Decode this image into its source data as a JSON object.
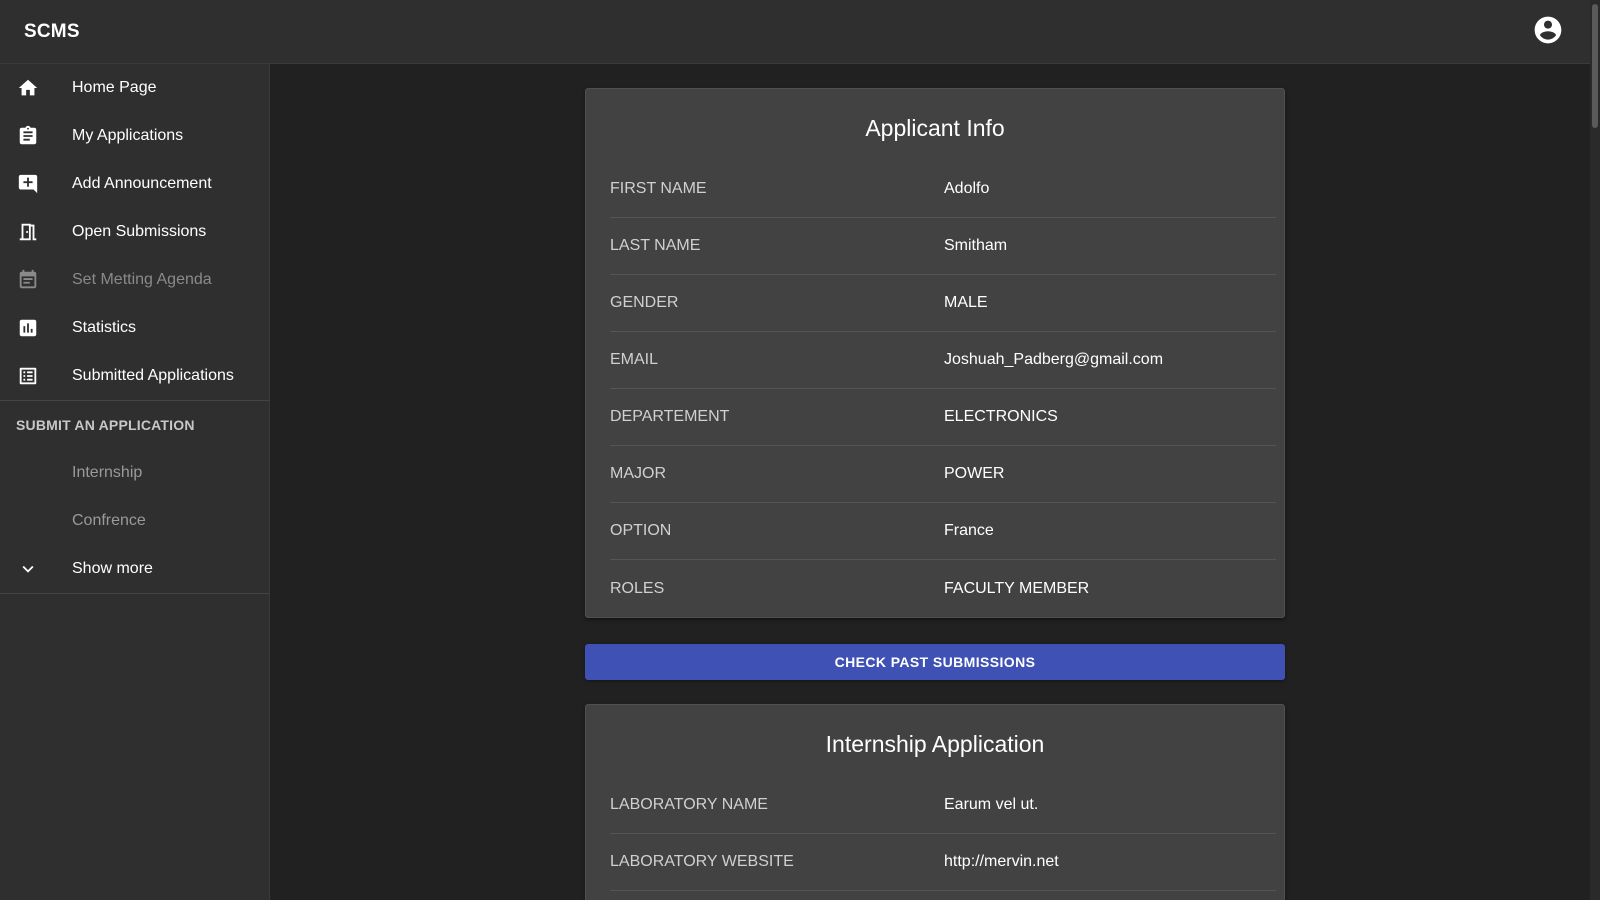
{
  "app": {
    "title": "SCMS"
  },
  "header": {
    "account_icon": "account-circle-icon"
  },
  "sidebar": {
    "items": [
      {
        "label": "Home Page",
        "icon": "home-icon"
      },
      {
        "label": "My Applications",
        "icon": "clipboard-icon"
      },
      {
        "label": "Add Announcement",
        "icon": "add-comment-icon"
      },
      {
        "label": "Open Submissions",
        "icon": "door-open-icon"
      },
      {
        "label": "Set Metting Agenda",
        "icon": "calendar-icon",
        "disabled": true
      },
      {
        "label": "Statistics",
        "icon": "bar-chart-icon"
      },
      {
        "label": "Submitted Applications",
        "icon": "list-alt-icon"
      }
    ],
    "submit_section": {
      "heading": "SUBMIT AN APPLICATION",
      "items": [
        "Internship",
        "Confrence"
      ],
      "show_more": "Show more"
    }
  },
  "applicant_info": {
    "title": "Applicant Info",
    "fields": [
      {
        "key": "FIRST NAME",
        "value": "Adolfo"
      },
      {
        "key": "LAST NAME",
        "value": "Smitham"
      },
      {
        "key": "GENDER",
        "value": "MALE"
      },
      {
        "key": "EMAIL",
        "value": "Joshuah_Padberg@gmail.com"
      },
      {
        "key": "DEPARTEMENT",
        "value": "ELECTRONICS"
      },
      {
        "key": "MAJOR",
        "value": "POWER"
      },
      {
        "key": "OPTION",
        "value": "France"
      },
      {
        "key": "ROLES",
        "value": "FACULTY MEMBER"
      }
    ]
  },
  "actions": {
    "check_past": "CHECK PAST SUBMISSIONS"
  },
  "internship_application": {
    "title": "Internship Application",
    "fields": [
      {
        "key": "LABORATORY NAME",
        "value": "Earum vel ut."
      },
      {
        "key": "LABORATORY WEBSITE",
        "value": "http://mervin.net"
      }
    ]
  },
  "colors": {
    "background": "#212121",
    "surface": "#2f2f2f",
    "card": "#424242",
    "primary": "#3f51b5"
  }
}
